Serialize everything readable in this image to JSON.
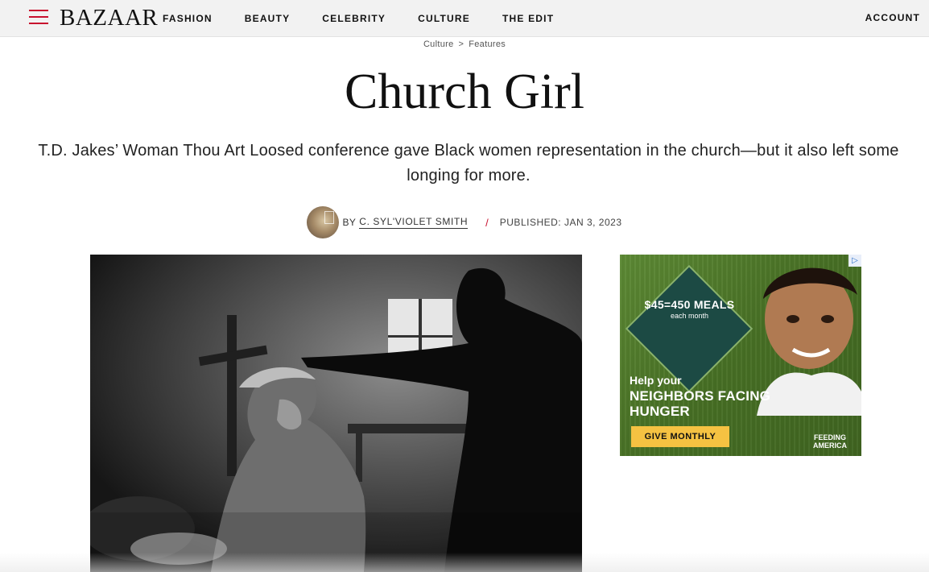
{
  "header": {
    "logo": "BAZAAR",
    "nav": [
      "FASHION",
      "BEAUTY",
      "CELEBRITY",
      "CULTURE",
      "THE EDIT"
    ],
    "account": "ACCOUNT"
  },
  "breadcrumb": {
    "items": [
      "Culture",
      "Features"
    ],
    "separator": ">"
  },
  "article": {
    "title": "Church Girl",
    "dek": "T.D. Jakes’ Woman Thou Art Loosed conference gave Black women representation in the church—but it also left some longing for more.",
    "by_prefix": "BY",
    "author": "C. SYL'VIOLET SMITH",
    "divider": "/",
    "published": "PUBLISHED: JAN 3, 2023"
  },
  "ad": {
    "offer_big": "$45=450 MEALS",
    "offer_small": "each month",
    "help": "Help your",
    "headline": "NEIGHBORS FACING HUNGER",
    "cta": "GIVE MONTHLY",
    "brand": "FEEDING AMERICA",
    "choices_icon": "ad-choices-icon"
  },
  "colors": {
    "accent": "#c8102e",
    "nav_bg": "#f2f2f2",
    "ad_green": "#4e7a2a",
    "ad_cta": "#f5c242"
  }
}
